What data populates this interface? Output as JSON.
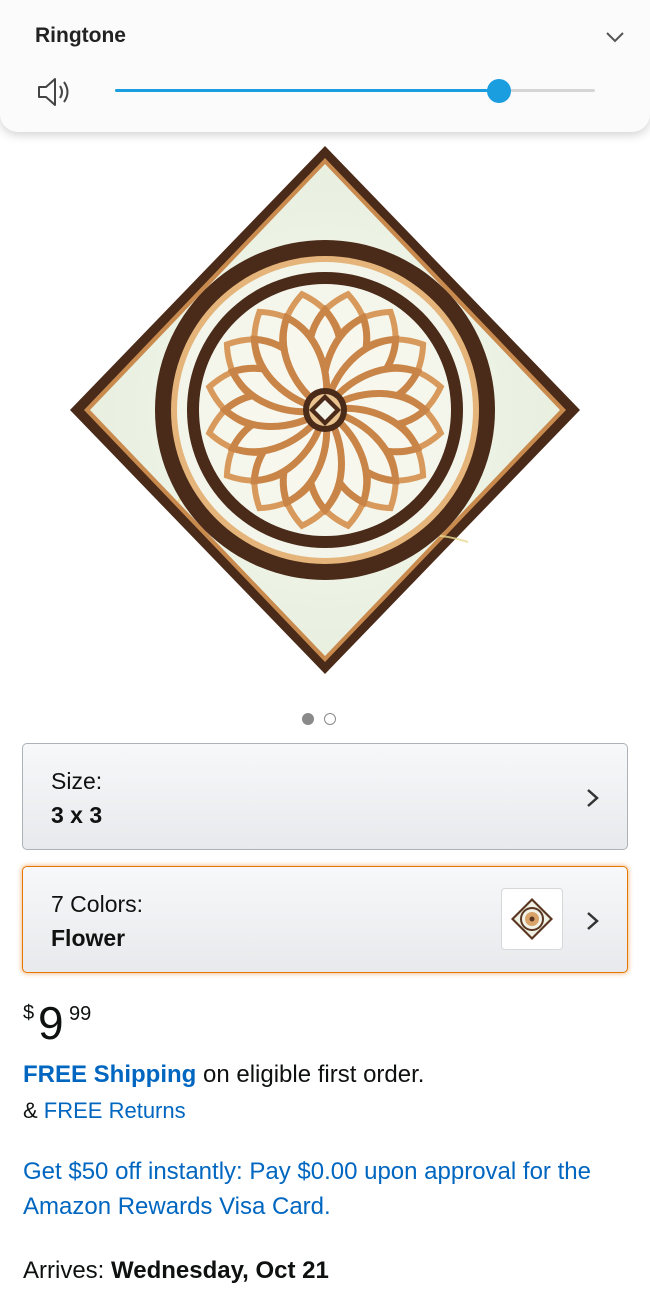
{
  "volume_panel": {
    "title": "Ringtone",
    "level": 0.8,
    "accent_color": "#1a9ee0",
    "icons": [
      "speaker-icon",
      "chevron-down-icon"
    ]
  },
  "product": {
    "image_name": "diamond-medallion-tile",
    "carousel": {
      "count": 2,
      "active": 1
    }
  },
  "variations": {
    "size": {
      "label": "Size:",
      "value": "3 x 3"
    },
    "color": {
      "label": "7 Colors:",
      "value": "Flower"
    }
  },
  "price": {
    "symbol": "$",
    "whole": "9",
    "fraction": "99"
  },
  "shipping": {
    "link": "FREE Shipping",
    "text": " on eligible first order."
  },
  "returns": {
    "prefix": "& ",
    "link": "FREE Returns"
  },
  "promo": {
    "text": "Get $50 off instantly: Pay $0.00 upon approval for the Amazon Rewards Visa Card."
  },
  "delivery": {
    "label": "Arrives: ",
    "date": "Wednesday, Oct 21"
  },
  "colors": {
    "link": "#0066c0",
    "selected_border": "#e77600"
  }
}
